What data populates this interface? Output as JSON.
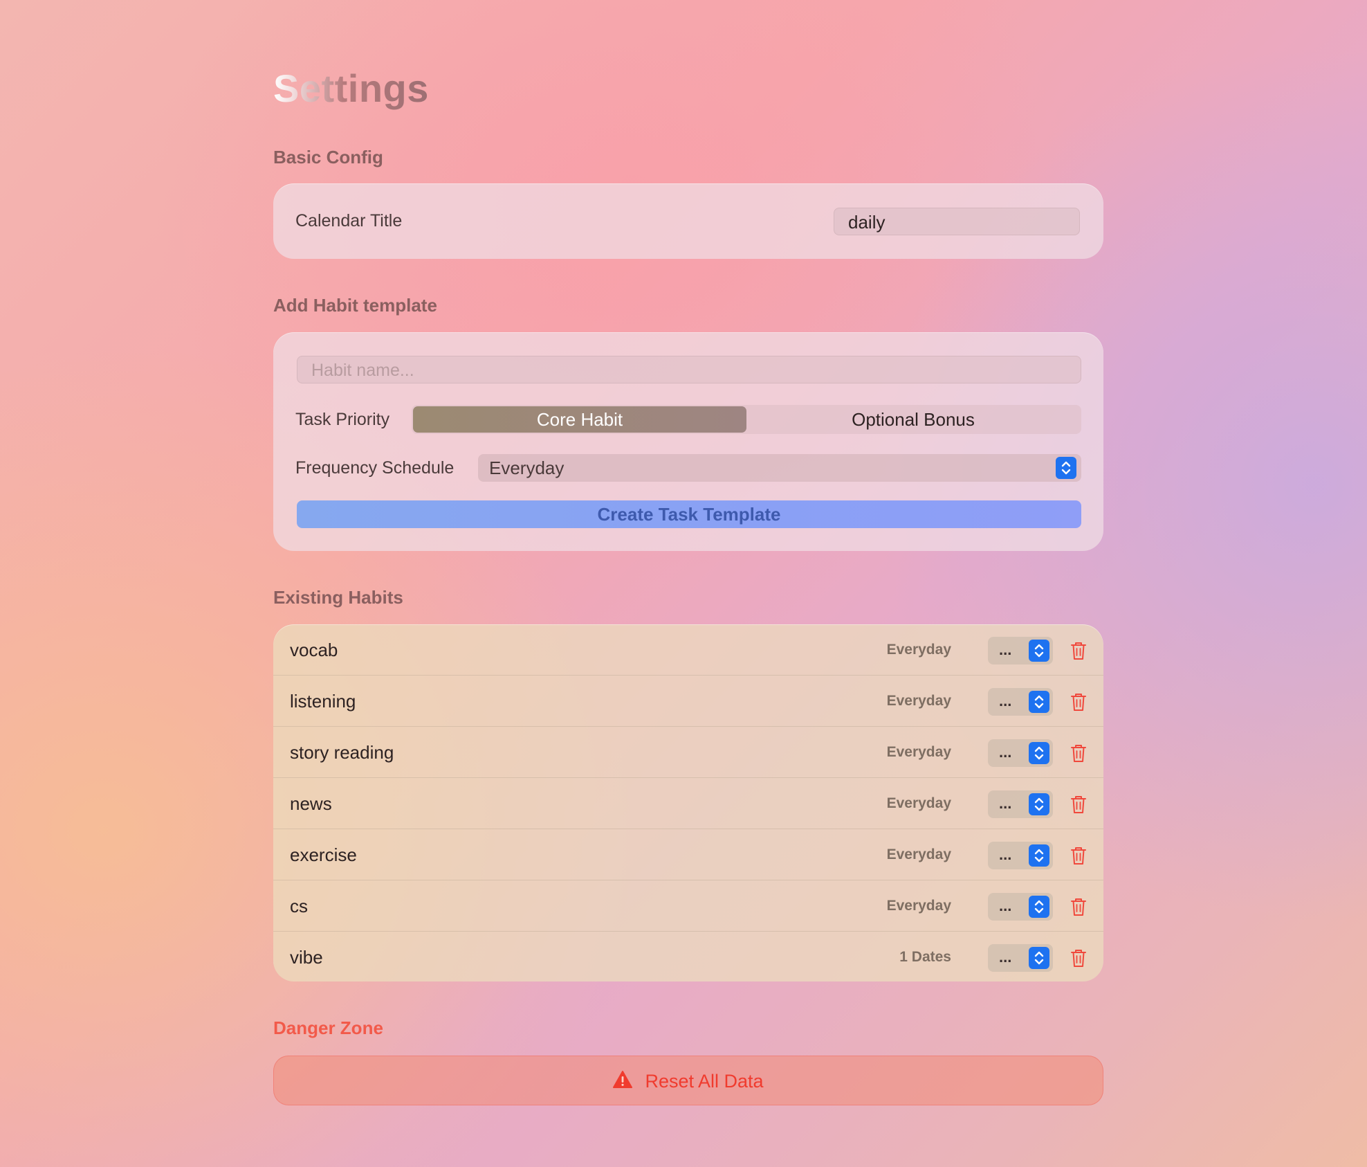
{
  "page": {
    "title": "Settings"
  },
  "basic_config": {
    "heading": "Basic Config",
    "calendar_title_label": "Calendar Title",
    "calendar_title_value": "daily"
  },
  "add_habit": {
    "heading": "Add Habit template",
    "name_placeholder": "Habit name...",
    "priority_label": "Task Priority",
    "priority_options": [
      "Core Habit",
      "Optional Bonus"
    ],
    "priority_selected": "Core Habit",
    "frequency_label": "Frequency Schedule",
    "frequency_value": "Everyday",
    "create_button": "Create Task Template"
  },
  "existing_habits": {
    "heading": "Existing Habits",
    "items": [
      {
        "name": "vocab",
        "frequency": "Everyday",
        "picker": "..."
      },
      {
        "name": "listening",
        "frequency": "Everyday",
        "picker": "..."
      },
      {
        "name": "story reading",
        "frequency": "Everyday",
        "picker": "..."
      },
      {
        "name": "news",
        "frequency": "Everyday",
        "picker": "..."
      },
      {
        "name": "exercise",
        "frequency": "Everyday",
        "picker": "..."
      },
      {
        "name": "cs",
        "frequency": "Everyday",
        "picker": "..."
      },
      {
        "name": "vibe",
        "frequency": "1 Dates",
        "picker": "..."
      }
    ]
  },
  "danger_zone": {
    "heading": "Danger Zone",
    "reset_button": "Reset All Data"
  },
  "icons": {
    "stepper": "chevron-up-down-icon",
    "delete": "trash-icon",
    "warning": "warning-triangle-icon"
  },
  "colors": {
    "accent_blue": "#1e72f0",
    "danger_red": "#f03b2e",
    "create_button": "#8aa0f5"
  }
}
